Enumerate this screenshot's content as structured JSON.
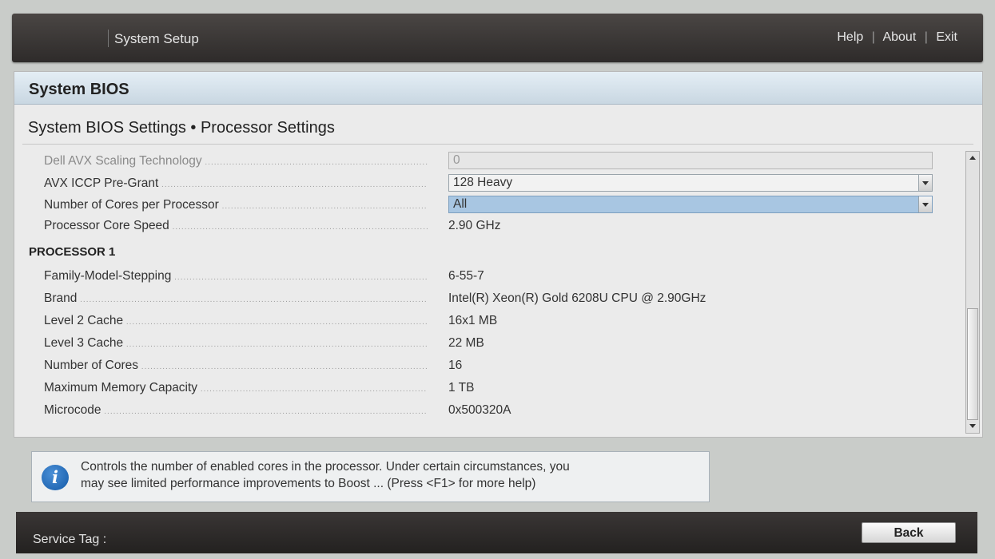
{
  "header": {
    "title": "System Setup",
    "links": {
      "help": "Help",
      "about": "About",
      "exit": "Exit",
      "separator": "|"
    }
  },
  "panel": {
    "title": "System BIOS",
    "breadcrumb": "System BIOS Settings • Processor Settings"
  },
  "settings": [
    {
      "label": "Dell AVX Scaling Technology",
      "value": "0",
      "kind": "input",
      "state": "disabled"
    },
    {
      "label": "AVX ICCP Pre-Grant",
      "value": "128 Heavy",
      "kind": "dropdown",
      "state": "normal"
    },
    {
      "label": "Number of Cores per Processor",
      "value": "All",
      "kind": "dropdown",
      "state": "selected"
    },
    {
      "label": "Processor Core Speed",
      "value": "2.90 GHz",
      "kind": "text"
    }
  ],
  "processor_section": {
    "title": "PROCESSOR 1",
    "rows": [
      {
        "label": "Family-Model-Stepping",
        "value": "6-55-7"
      },
      {
        "label": "Brand",
        "value": "Intel(R) Xeon(R) Gold 6208U CPU @ 2.90GHz"
      },
      {
        "label": "Level 2 Cache",
        "value": "16x1 MB"
      },
      {
        "label": "Level 3 Cache",
        "value": "22 MB"
      },
      {
        "label": "Number of Cores",
        "value": "16"
      },
      {
        "label": "Maximum Memory Capacity",
        "value": "1 TB"
      },
      {
        "label": "Microcode",
        "value": "0x500320A"
      }
    ]
  },
  "help": {
    "icon": "info-icon",
    "line1": "Controls the number of enabled cores in the processor. Under certain circumstances, you",
    "line2": "may see limited performance improvements to Boost ... (Press <F1> for more help)"
  },
  "footer": {
    "service_tag_label": "Service Tag :",
    "back_label": "Back"
  },
  "colors": {
    "topbar": "#3a3635",
    "header_gradient_start": "#e4eef5",
    "selected_field": "#a8c6e2",
    "info_icon": "#135aa8"
  }
}
